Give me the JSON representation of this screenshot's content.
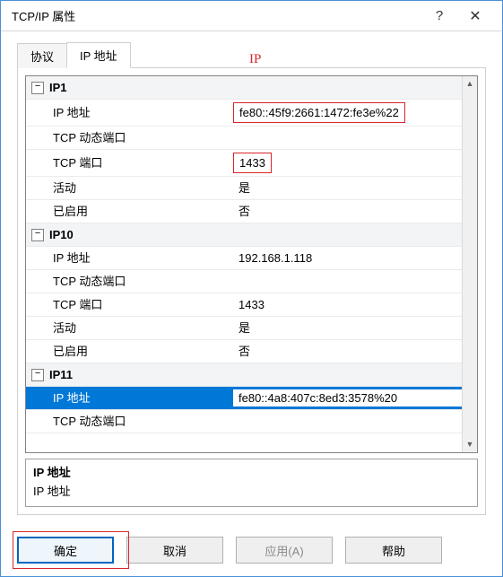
{
  "window": {
    "title": "TCP/IP 属性",
    "help_symbol": "?",
    "close_symbol": "✕"
  },
  "tabs": {
    "protocol": "协议",
    "ip_addr": "IP 地址"
  },
  "annotation": "IP",
  "groups": [
    {
      "name": "IP1",
      "rows": [
        {
          "label": "IP 地址",
          "value": "fe80::45f9:2661:1472:fe3e%22",
          "highlight": true
        },
        {
          "label": "TCP 动态端口",
          "value": ""
        },
        {
          "label": "TCP 端口",
          "value": "1433",
          "highlight": true
        },
        {
          "label": "活动",
          "value": "是"
        },
        {
          "label": "已启用",
          "value": "否"
        }
      ]
    },
    {
      "name": "IP10",
      "rows": [
        {
          "label": "IP 地址",
          "value": "192.168.1.118"
        },
        {
          "label": "TCP 动态端口",
          "value": ""
        },
        {
          "label": "TCP 端口",
          "value": "1433"
        },
        {
          "label": "活动",
          "value": "是"
        },
        {
          "label": "已启用",
          "value": "否"
        }
      ]
    },
    {
      "name": "IP11",
      "rows": [
        {
          "label": "IP 地址",
          "value": "fe80::4a8:407c:8ed3:3578%20",
          "selected": true
        },
        {
          "label": "TCP 动态端口",
          "value": ""
        }
      ]
    }
  ],
  "desc": {
    "title": "IP 地址",
    "text": "IP 地址"
  },
  "buttons": {
    "ok": "确定",
    "cancel": "取消",
    "apply": "应用(A)",
    "help": "帮助"
  },
  "collapse_symbol": "−"
}
